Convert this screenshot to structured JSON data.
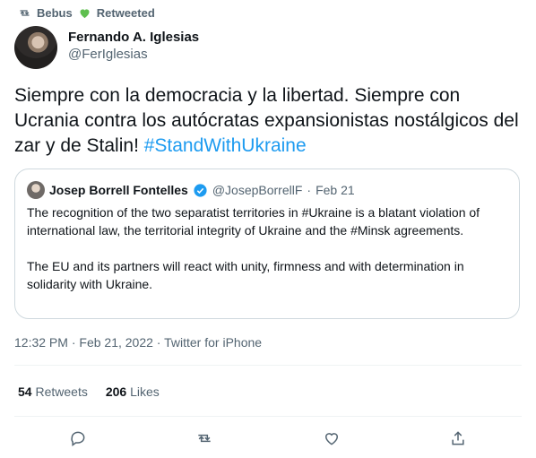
{
  "retweet_header": {
    "user": "Bebus",
    "label": "Retweeted"
  },
  "author": {
    "name": "Fernando A. Iglesias",
    "handle": "@FerIglesias"
  },
  "tweet": {
    "text": "Siempre con la democracia y la libertad. Siempre con Ucrania contra los autócratas expansionistas nostálgicos del zar y de Stalin! ",
    "hashtag": "#StandWithUkraine"
  },
  "quote": {
    "name": "Josep Borrell Fontelles",
    "handle": "@JosepBorrellF",
    "separator": "·",
    "date": "Feb 21",
    "paragraph1": "The recognition of the two separatist territories in #Ukraine is a blatant violation of international law, the territorial integrity of Ukraine and the #Minsk agreements.",
    "paragraph2": "The EU and its partners will react with unity, firmness and with determination in solidarity with Ukraine."
  },
  "meta": {
    "time": "12:32 PM",
    "separator": "·",
    "date": "Feb 21, 2022",
    "source": "Twitter for iPhone"
  },
  "stats": {
    "retweets_count": "54",
    "retweets_label": "Retweets",
    "likes_count": "206",
    "likes_label": "Likes"
  },
  "colors": {
    "link": "#1d9bf0",
    "secondary_text": "#536471",
    "heart": "#5fbf4f",
    "verified": "#1d9bf0"
  },
  "icons": [
    "retweet-icon",
    "green-heart-icon",
    "verified-badge-icon",
    "reply-icon",
    "retweet-action-icon",
    "like-icon",
    "share-icon"
  ]
}
